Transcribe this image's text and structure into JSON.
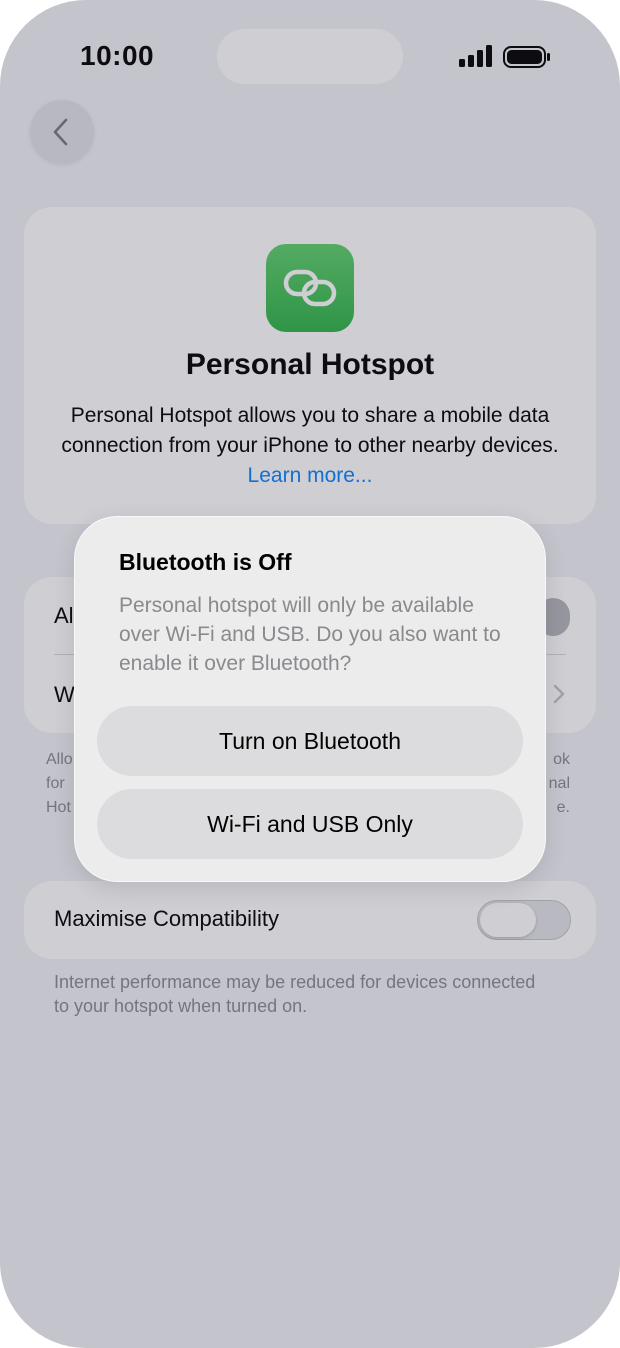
{
  "status_bar": {
    "time": "10:00"
  },
  "header": {
    "app_icon": "link-chain-icon",
    "title": "Personal Hotspot",
    "description": "Personal Hotspot allows you to share a mobile data connection from your iPhone to other nearby devices.",
    "learn_more": "Learn more..."
  },
  "settings": {
    "row1_label": "Al",
    "row2_label": "W",
    "footer_left": [
      "Allo",
      "for",
      "Hot"
    ],
    "footer_right": [
      "ok",
      "nal",
      "e."
    ],
    "maximise_label": "Maximise Compatibility",
    "maximise_on": false,
    "maximise_footer": "Internet performance may be reduced for devices connected to your hotspot when turned on."
  },
  "alert": {
    "title": "Bluetooth is Off",
    "message": "Personal hotspot will only be available over Wi-Fi and USB. Do you also want to enable it over Bluetooth?",
    "primary_button": "Turn on Bluetooth",
    "secondary_button": "Wi-Fi and USB Only"
  },
  "colors": {
    "accent": "#0a84ff",
    "icon_green": "#34c759"
  }
}
